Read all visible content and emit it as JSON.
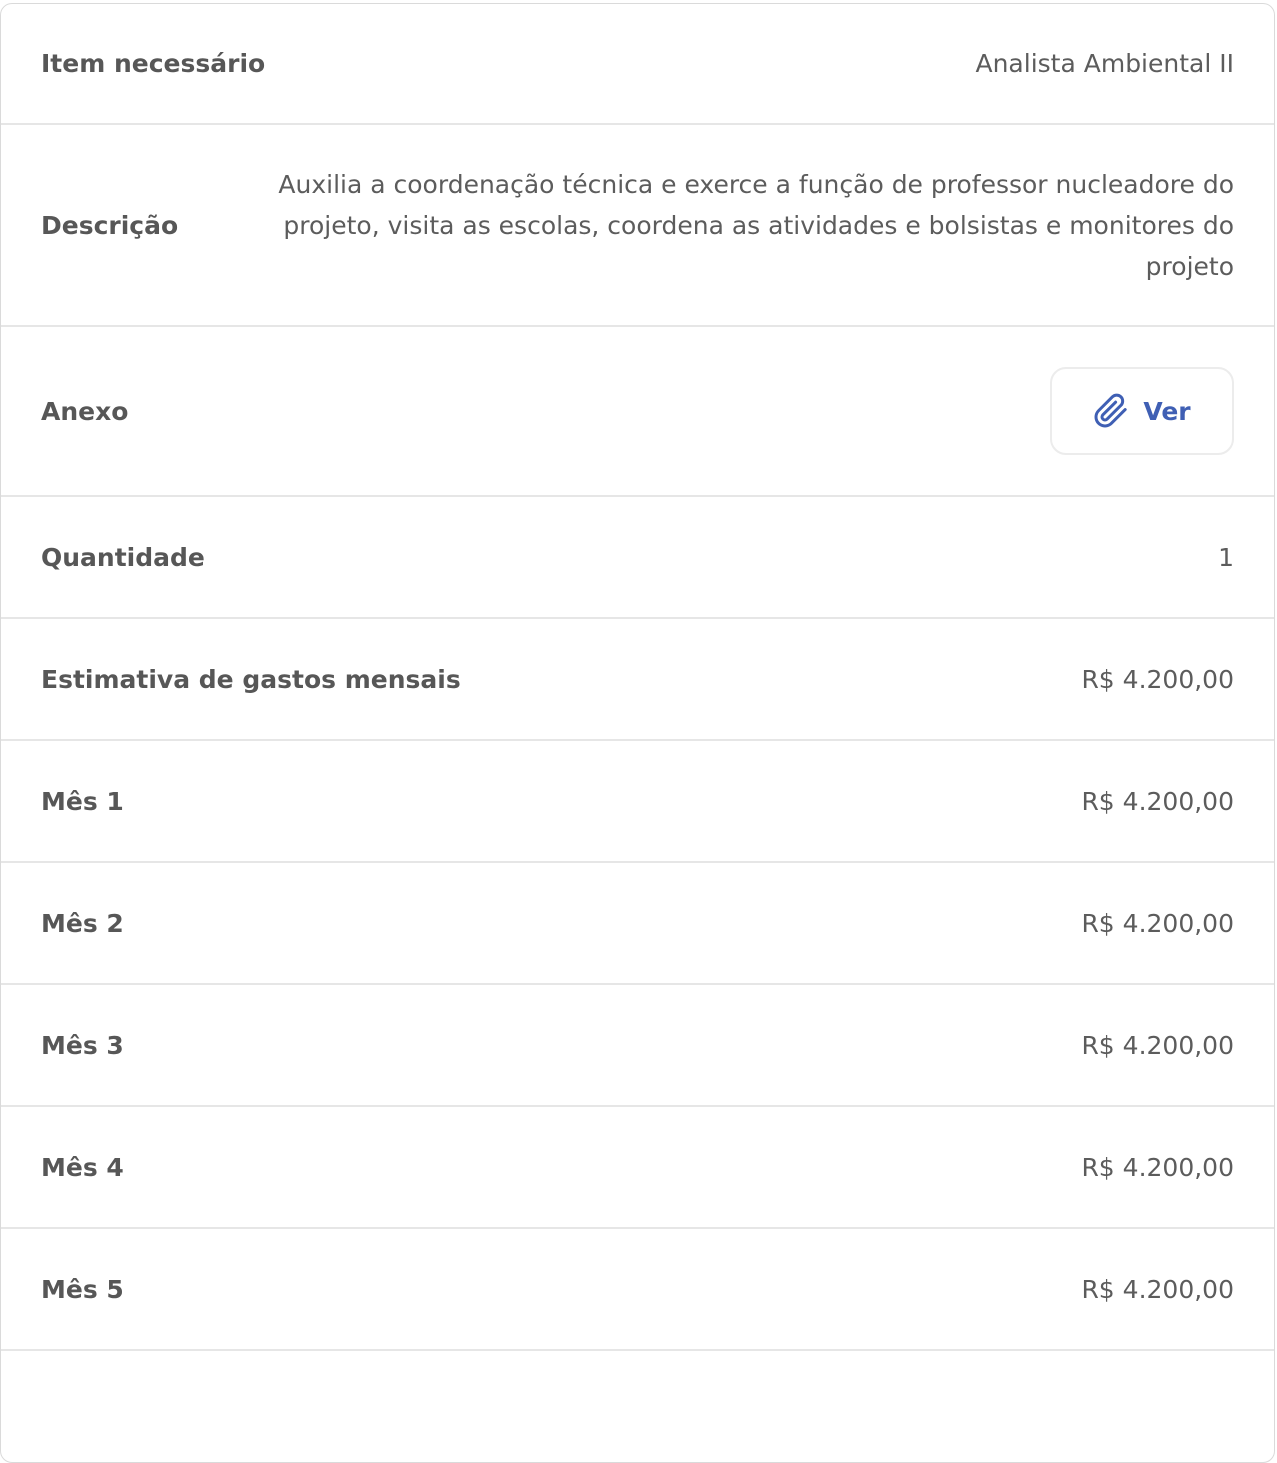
{
  "rows": {
    "item": {
      "label": "Item necessário",
      "value": "Analista Ambiental II"
    },
    "descricao": {
      "label": "Descrição",
      "value": "Auxilia a coordenação técnica e exerce a função de professor nucleadore do projeto, visita as escolas, coordena as atividades e bolsistas e monitores do projeto"
    },
    "anexo": {
      "label": "Anexo",
      "button_label": "Ver",
      "icon": "paperclip-icon"
    },
    "quantidade": {
      "label": "Quantidade",
      "value": "1"
    },
    "estimativa": {
      "label": "Estimativa de gastos mensais",
      "value": "R$ 4.200,00"
    },
    "mes1": {
      "label": "Mês 1",
      "value": "R$ 4.200,00"
    },
    "mes2": {
      "label": "Mês 2",
      "value": "R$ 4.200,00"
    },
    "mes3": {
      "label": "Mês 3",
      "value": "R$ 4.200,00"
    },
    "mes4": {
      "label": "Mês 4",
      "value": "R$ 4.200,00"
    },
    "mes5": {
      "label": "Mês 5",
      "value": "R$ 4.200,00"
    }
  },
  "colors": {
    "label": "#575757",
    "value": "#5c5c5c",
    "accent": "#3f5fb4",
    "divider": "#e6e6e6"
  }
}
